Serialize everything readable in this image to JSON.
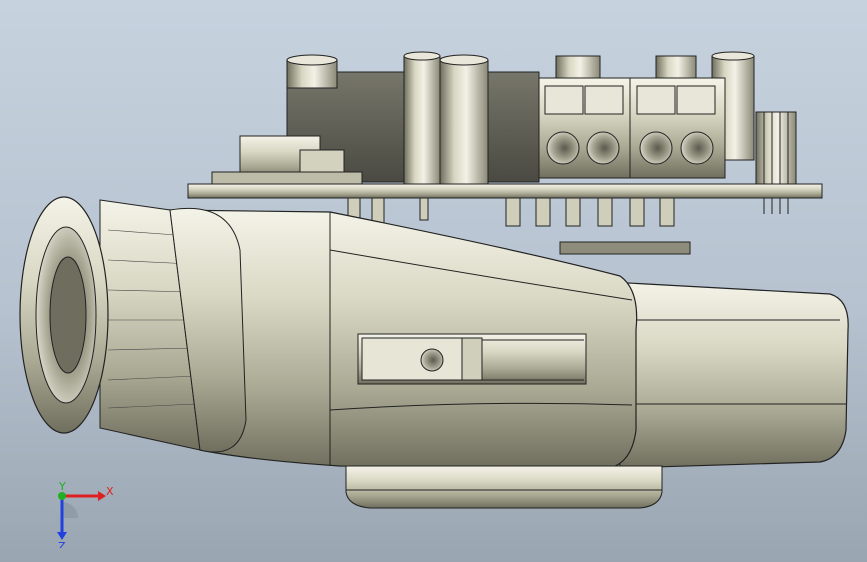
{
  "viewport": {
    "background_top": "#c7d2df",
    "background_bottom": "#9aa5b2",
    "model_color": "#c9c8b3",
    "edge_color": "#1e1e1e"
  },
  "triad": {
    "x_label": "X",
    "y_label": "Y",
    "z_label": "Z",
    "x_color": "#e02020",
    "y_color": "#20b020",
    "z_color": "#2040e0"
  }
}
